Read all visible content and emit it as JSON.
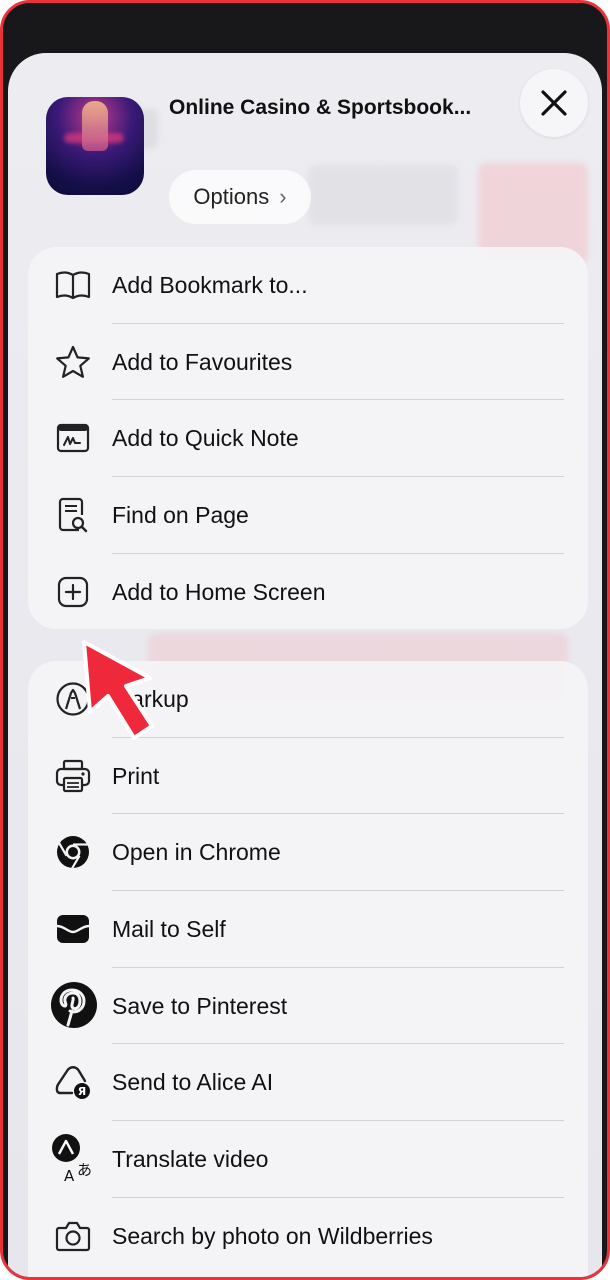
{
  "app": {
    "title": "Online Casino & Sportsbook...",
    "options_label": "Options",
    "options_chevron": "›",
    "close_icon": "close-icon"
  },
  "group1": {
    "items": [
      {
        "label": "Add Bookmark to...",
        "icon": "book-icon"
      },
      {
        "label": "Add to Favourites",
        "icon": "star-icon"
      },
      {
        "label": "Add to Quick Note",
        "icon": "quick-note-icon"
      },
      {
        "label": "Find on Page",
        "icon": "find-on-page-icon"
      },
      {
        "label": "Add to Home Screen",
        "icon": "add-square-icon"
      }
    ]
  },
  "group2": {
    "items": [
      {
        "label": "Markup",
        "icon": "markup-icon"
      },
      {
        "label": "Print",
        "icon": "printer-icon"
      },
      {
        "label": "Open in Chrome",
        "icon": "chrome-icon"
      },
      {
        "label": "Mail to Self",
        "icon": "mail-icon"
      },
      {
        "label": "Save to Pinterest",
        "icon": "pinterest-icon"
      },
      {
        "label": "Send to Alice AI",
        "icon": "alice-icon"
      },
      {
        "label": "Translate video",
        "icon": "translate-icon"
      },
      {
        "label": "Search by photo on Wildberries",
        "icon": "camera-icon"
      }
    ]
  },
  "colors": {
    "highlight_border": "#e8333a",
    "pointer_arrow": "#f0283c"
  }
}
